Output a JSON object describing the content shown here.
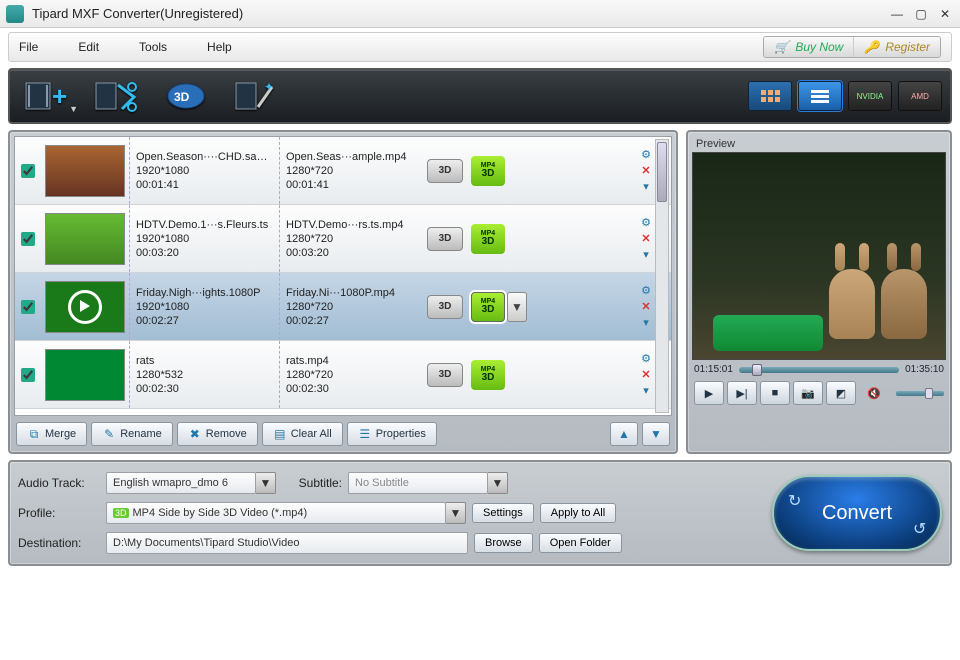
{
  "window": {
    "title": "Tipard MXF Converter(Unregistered)"
  },
  "menu": {
    "file": "File",
    "edit": "Edit",
    "tools": "Tools",
    "help": "Help",
    "buy": "Buy Now",
    "register": "Register"
  },
  "toolbar": {
    "add": "add-file",
    "cut": "trim",
    "threeD": "3D",
    "effect": "effect",
    "viewGrid": "grid",
    "viewList": "list",
    "nvidia": "NVIDIA",
    "amd": "AMD"
  },
  "files": [
    {
      "checked": true,
      "srcName": "Open.Season····CHD.sample",
      "srcRes": "1920*1080",
      "srcDur": "00:01:41",
      "dstName": "Open.Seas···ample.mp4",
      "dstRes": "1280*720",
      "dstDur": "00:01:41",
      "badge": "3D",
      "fmt": "MP4 3D"
    },
    {
      "checked": true,
      "srcName": "HDTV.Demo.1···s.Fleurs.ts",
      "srcRes": "1920*1080",
      "srcDur": "00:03:20",
      "dstName": "HDTV.Demo···rs.ts.mp4",
      "dstRes": "1280*720",
      "dstDur": "00:03:20",
      "badge": "3D",
      "fmt": "MP4 3D"
    },
    {
      "checked": true,
      "srcName": "Friday.Nigh···ights.1080P",
      "srcRes": "1920*1080",
      "srcDur": "00:02:27",
      "dstName": "Friday.Ni···1080P.mp4",
      "dstRes": "1280*720",
      "dstDur": "00:02:27",
      "badge": "3D",
      "fmt": "MP4 3D",
      "selected": true
    },
    {
      "checked": true,
      "srcName": "rats",
      "srcRes": "1280*532",
      "srcDur": "00:02:30",
      "dstName": "rats.mp4",
      "dstRes": "1280*720",
      "dstDur": "00:02:30",
      "badge": "3D",
      "fmt": "MP4 3D"
    }
  ],
  "listTools": {
    "merge": "Merge",
    "rename": "Rename",
    "remove": "Remove",
    "clear": "Clear All",
    "props": "Properties"
  },
  "preview": {
    "label": "Preview",
    "t1": "01:15:01",
    "t2": "01:35:10"
  },
  "settings": {
    "audioTrackLabel": "Audio Track:",
    "audioTrack": "English wmapro_dmo 6",
    "subtitleLabel": "Subtitle:",
    "subtitle": "No Subtitle",
    "profileLabel": "Profile:",
    "profile": "MP4 Side by Side 3D Video (*.mp4)",
    "settingsBtn": "Settings",
    "applyAll": "Apply to All",
    "destLabel": "Destination:",
    "dest": "D:\\My Documents\\Tipard Studio\\Video",
    "browse": "Browse",
    "openFolder": "Open Folder",
    "convert": "Convert"
  }
}
